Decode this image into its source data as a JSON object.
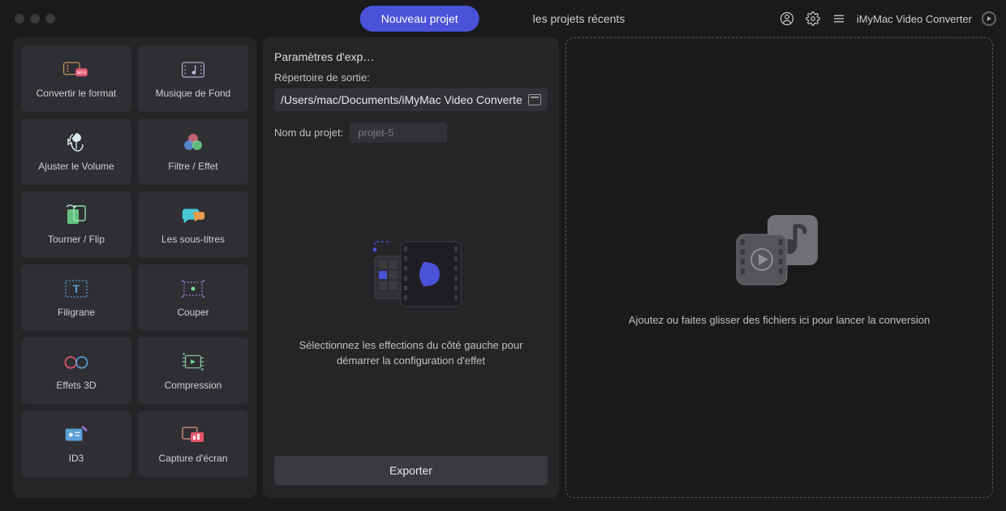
{
  "header": {
    "tab_new_project": "Nouveau projet",
    "tab_recent_projects": "les projets récents",
    "app_name": "iMyMac Video Converter"
  },
  "sidebar": {
    "tools": [
      {
        "label": "Convertir le format",
        "icon": "format-convert"
      },
      {
        "label": "Musique de Fond",
        "icon": "background-music"
      },
      {
        "label": "Ajuster le Volume",
        "icon": "adjust-volume"
      },
      {
        "label": "Filtre / Effet",
        "icon": "filter-effect"
      },
      {
        "label": "Tourner / Flip",
        "icon": "rotate-flip"
      },
      {
        "label": "Les sous-titres",
        "icon": "subtitles"
      },
      {
        "label": "Filigrane",
        "icon": "watermark"
      },
      {
        "label": "Couper",
        "icon": "cut"
      },
      {
        "label": "Effets 3D",
        "icon": "effects-3d"
      },
      {
        "label": "Compression",
        "icon": "compression"
      },
      {
        "label": "ID3",
        "icon": "id3"
      },
      {
        "label": "Capture d'écran",
        "icon": "screenshot"
      }
    ]
  },
  "middle": {
    "title": "Paramètres d'exp…",
    "output_dir_label": "Répertoire de sortie:",
    "output_dir_value": "/Users/mac/Documents/iMyMac Video Converte",
    "project_name_label": "Nom du projet:",
    "project_name_value": "projet-5",
    "placeholder_text": "Sélectionnez les effections du côté gauche pour démarrer la configuration d'effet",
    "export_button": "Exporter"
  },
  "drop": {
    "message": "Ajoutez ou faites glisser des fichiers ici pour lancer la conversion"
  }
}
